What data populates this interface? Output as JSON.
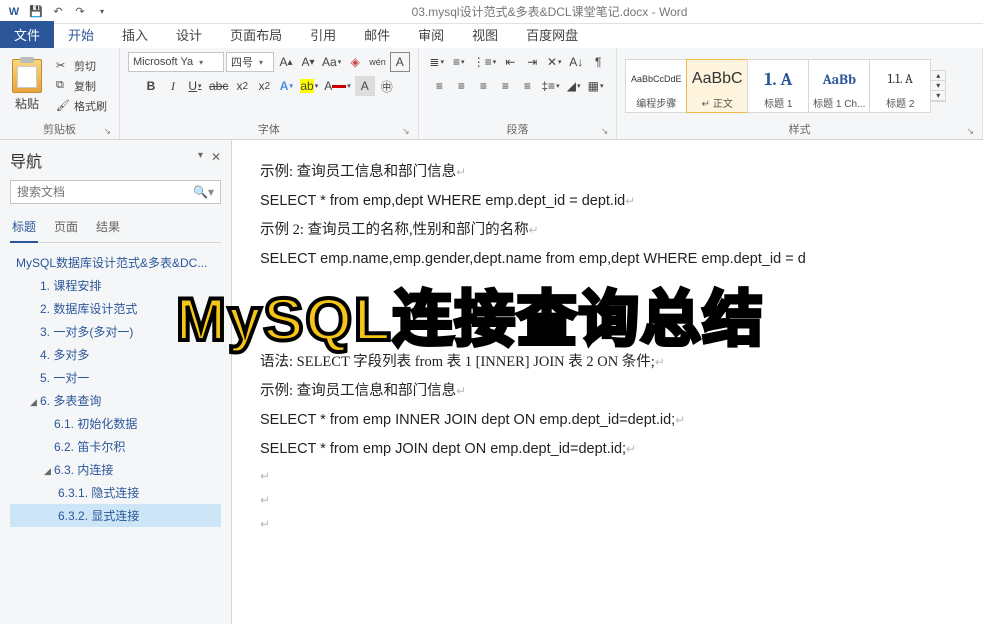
{
  "titlebar": {
    "doc_title": "03.mysql设计范式&多表&DCL课堂笔记.docx - Word"
  },
  "tabs": {
    "file": "文件",
    "home": "开始",
    "insert": "插入",
    "design": "设计",
    "layout": "页面布局",
    "references": "引用",
    "mail": "邮件",
    "review": "审阅",
    "view": "视图",
    "baidu": "百度网盘"
  },
  "clipboard": {
    "paste": "粘贴",
    "cut": "剪切",
    "copy": "复制",
    "format_painter": "格式刷",
    "group": "剪贴板"
  },
  "font": {
    "name": "Microsoft Ya",
    "size": "四号",
    "group": "字体"
  },
  "paragraph": {
    "group": "段落"
  },
  "styles": {
    "s1_prev": "AaBbCcDdE",
    "s1_name": "编程步骤",
    "s2_prev": "AaBbC",
    "s2_name": "↵ 正文",
    "s3_prev": "1. A",
    "s3_name": "标题 1",
    "s4_prev": "AaBb",
    "s4_name": "标题 1 Ch...",
    "s5_prev": "1.1. A",
    "s5_name": "标题 2",
    "group": "样式"
  },
  "nav": {
    "title": "导航",
    "search_placeholder": "搜索文档",
    "tab_headings": "标题",
    "tab_pages": "页面",
    "tab_results": "结果",
    "items": [
      {
        "t": "MySQL数据库设计范式&多表&DC...",
        "lvl": 0
      },
      {
        "t": "1. 课程安排",
        "lvl": 1
      },
      {
        "t": "2. 数据库设计范式",
        "lvl": 1
      },
      {
        "t": "3. 一对多(多对一)",
        "lvl": 1
      },
      {
        "t": "4. 多对多",
        "lvl": 1
      },
      {
        "t": "5. 一对一",
        "lvl": 1
      },
      {
        "t": "6. 多表查询",
        "lvl": 1,
        "exp": true
      },
      {
        "t": "6.1. 初始化数据",
        "lvl": 2
      },
      {
        "t": "6.2. 笛卡尔积",
        "lvl": 2
      },
      {
        "t": "6.3. 内连接",
        "lvl": 2,
        "exp": true
      },
      {
        "t": "6.3.1. 隐式连接",
        "lvl": 3
      },
      {
        "t": "6.3.2. 显式连接",
        "lvl": 3,
        "sel": true
      }
    ]
  },
  "doc": {
    "l1": "示例:  查询员工信息和部门信息",
    "l2": "SELECT * from emp,dept WHERE emp.dept_id = dept.id",
    "l3": "示例 2:  查询员工的名称,性别和部门的名称",
    "l4": "SELECT emp.name,emp.gender,dept.name from emp,dept WHERE emp.dept_id = d",
    "l5": "语法: SELECT  字段列表  from  表 1 [INNER] JOIN  表 2   ON  条件;",
    "l6": "示例:  查询员工信息和部门信息",
    "l7": "SELECT * from emp INNER JOIN dept ON emp.dept_id=dept.id;",
    "l8": "SELECT * from emp   JOIN dept ON emp.dept_id=dept.id;"
  },
  "overlay": {
    "title": "MySQL连接查询总结"
  }
}
